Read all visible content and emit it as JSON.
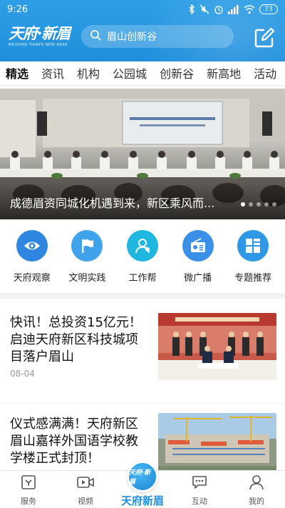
{
  "status_bar": {
    "time": "9:26",
    "battery": "73"
  },
  "app_bar": {
    "logo_text": "天府·新眉",
    "logo_sub": "MEISHAN TIANFU NEW AREA",
    "search_placeholder": "眉山创新谷"
  },
  "tabs": [
    {
      "label": "精选",
      "active": true
    },
    {
      "label": "资讯"
    },
    {
      "label": "机构"
    },
    {
      "label": "公园城"
    },
    {
      "label": "创新谷"
    },
    {
      "label": "新高地"
    },
    {
      "label": "活动"
    }
  ],
  "banner": {
    "caption": "成德眉资同城化机遇到来，新区乘风而...",
    "slide_count": 5,
    "active_slide": 1
  },
  "quick_entries": [
    {
      "label": "天府观察",
      "icon": "eye-icon",
      "color": "#2f86e0"
    },
    {
      "label": "文明实践",
      "icon": "flag-icon",
      "color": "#3fa2ea"
    },
    {
      "label": "工作帮",
      "icon": "user-help-icon",
      "color": "#1fb6e0"
    },
    {
      "label": "微广播",
      "icon": "radio-icon",
      "color": "#3a8fe6"
    },
    {
      "label": "专题推荐",
      "icon": "topic-grid-icon",
      "color": "#2f98e6"
    }
  ],
  "news": [
    {
      "title": "快讯！总投资15亿元！启迪天府新区科技城项目落户眉山",
      "date": "08-04"
    },
    {
      "title": "仪式感满满！天府新区眉山嘉祥外国语学校教学楼正式封顶！",
      "date": ""
    }
  ],
  "bottom_nav": {
    "items": [
      {
        "label": "服务",
        "icon": "service-icon"
      },
      {
        "label": "视频",
        "icon": "video-icon"
      },
      {
        "label": "天府新眉",
        "icon": "home-logo-icon",
        "bubble_text": "天府·新眉"
      },
      {
        "label": "互动",
        "icon": "chat-icon"
      },
      {
        "label": "我的",
        "icon": "profile-icon"
      }
    ]
  },
  "colors": {
    "brand_blue": "#1f8fdc",
    "active_nav": "#1e8fdd"
  }
}
